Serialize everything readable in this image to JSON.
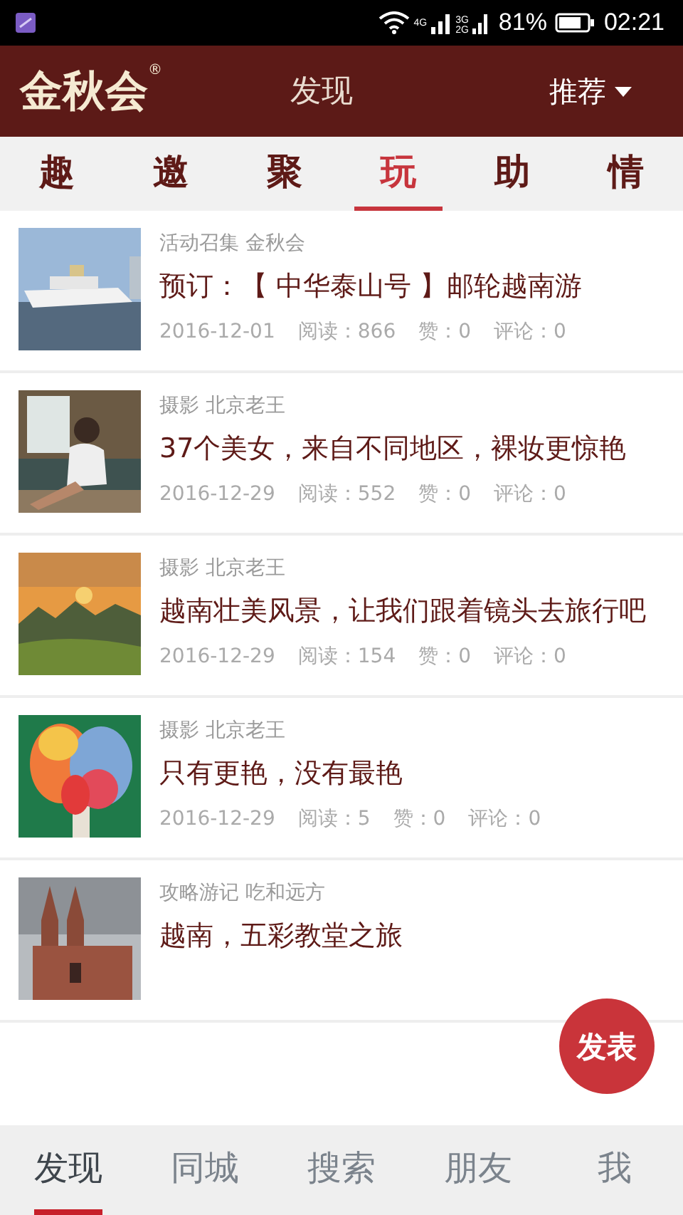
{
  "status_bar": {
    "net_4g": "4G",
    "net_3g": "3G",
    "net_2g": "2G",
    "battery": "81%",
    "time": "02:21"
  },
  "header": {
    "logo": "金秋会",
    "registered": "®",
    "title": "发现",
    "filter": "推荐"
  },
  "tabs": [
    {
      "label": "趣",
      "selected": false
    },
    {
      "label": "邀",
      "selected": false
    },
    {
      "label": "聚",
      "selected": false
    },
    {
      "label": "玩",
      "selected": true
    },
    {
      "label": "助",
      "selected": false
    },
    {
      "label": "情",
      "selected": false
    }
  ],
  "posts": [
    {
      "category": "活动召集 金秋会",
      "title": "预订：【 中华泰山号 】邮轮越南游",
      "date": "2016-12-01",
      "reads": "阅读：866",
      "likes": "赞：0",
      "comments": "评论：0"
    },
    {
      "category": "摄影 北京老王",
      "title": "37个美女，来自不同地区，裸妆更惊艳",
      "date": "2016-12-29",
      "reads": "阅读：552",
      "likes": "赞：0",
      "comments": "评论：0"
    },
    {
      "category": "摄影 北京老王",
      "title": "越南壮美风景，让我们跟着镜头去旅行吧",
      "date": "2016-12-29",
      "reads": "阅读：154",
      "likes": "赞：0",
      "comments": "评论：0"
    },
    {
      "category": "摄影 北京老王",
      "title": "只有更艳，没有最艳",
      "date": "2016-12-29",
      "reads": "阅读：5",
      "likes": "赞：0",
      "comments": "评论：0"
    },
    {
      "category": "攻略游记 吃和远方",
      "title": "越南，五彩教堂之旅"
    }
  ],
  "fab": "发表",
  "bottom_nav": [
    {
      "label": "发现",
      "selected": true
    },
    {
      "label": "同城",
      "selected": false
    },
    {
      "label": "搜索",
      "selected": false
    },
    {
      "label": "朋友",
      "selected": false
    },
    {
      "label": "我",
      "selected": false
    }
  ]
}
